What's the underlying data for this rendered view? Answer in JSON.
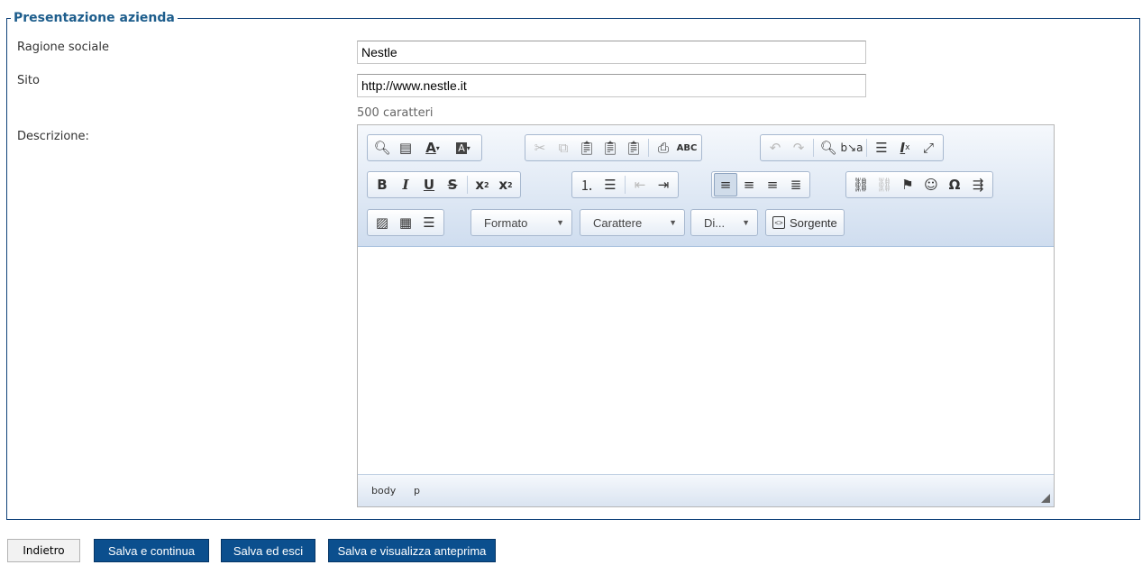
{
  "section": {
    "title": "Presentazione azienda"
  },
  "form": {
    "ragione_sociale": {
      "label": "Ragione sociale",
      "value": "Nestle"
    },
    "sito": {
      "label": "Sito",
      "value": "http://www.nestle.it"
    },
    "descrizione": {
      "label": "Descrizione:",
      "char_counter": "500 caratteri"
    }
  },
  "editor": {
    "toolbar": {
      "format_combo": "Formato",
      "font_combo": "Carattere",
      "size_combo": "Di...",
      "source_button": "Sorgente"
    },
    "content": "",
    "elements_path": [
      "body",
      "p"
    ]
  },
  "actions": {
    "back": "Indietro",
    "save_continue": "Salva e continua",
    "save_exit": "Salva ed esci",
    "save_preview": "Salva e visualizza anteprima"
  },
  "colors": {
    "legend": "#1d5d8c",
    "fieldset_border": "#10427a",
    "primary_button": "#0b4f8e",
    "toolbar_gradient_top": "#f5f8fc",
    "toolbar_gradient_bottom": "#cfddef"
  }
}
